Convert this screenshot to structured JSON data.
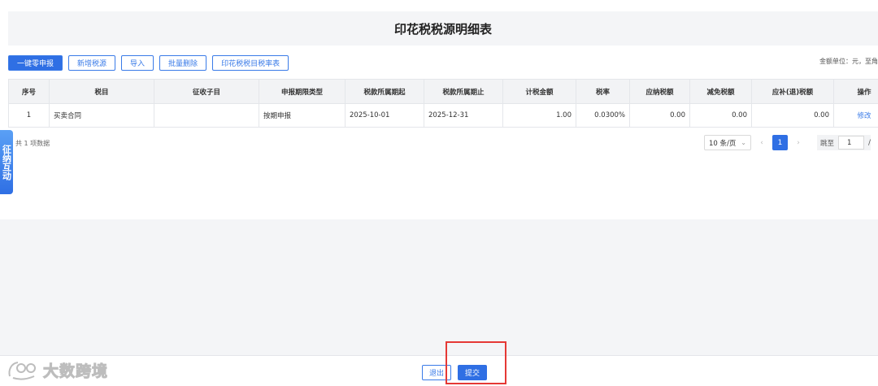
{
  "page": {
    "title": "印花税税源明细表",
    "unit_label": "金额单位：元，至角"
  },
  "toolbar": {
    "zero_declare": "一键零申报",
    "add_source": "新增税源",
    "import": "导入",
    "batch_delete": "批量删除",
    "rate_table": "印花税税目税率表"
  },
  "table": {
    "headers": [
      "序号",
      "税目",
      "征收子目",
      "申报期限类型",
      "税款所属期起",
      "税款所属期止",
      "计税金额",
      "税率",
      "应纳税额",
      "减免税额",
      "应补(退)税额",
      "操作"
    ],
    "rows": [
      {
        "no": "1",
        "item": "买卖合同",
        "sub_item": "",
        "period_type": "按期申报",
        "period_start": "2025-10-01",
        "period_end": "2025-12-31",
        "taxable_amount": "1.00",
        "rate": "0.0300%",
        "tax_payable": "0.00",
        "tax_relief": "0.00",
        "tax_due": "0.00",
        "action": "修改"
      }
    ]
  },
  "pagination": {
    "total": "共 1 项数据",
    "page_size": "10 条/页",
    "current_page": "1",
    "jump_label": "跳至",
    "jump_value": "1",
    "slash": "/"
  },
  "side_tab": {
    "label": "征纳互动"
  },
  "footer": {
    "exit": "退出",
    "submit": "提交"
  },
  "watermark": {
    "text": "大数跨境"
  },
  "colors": {
    "primary": "#2f6fe4",
    "highlight": "#e53935"
  }
}
